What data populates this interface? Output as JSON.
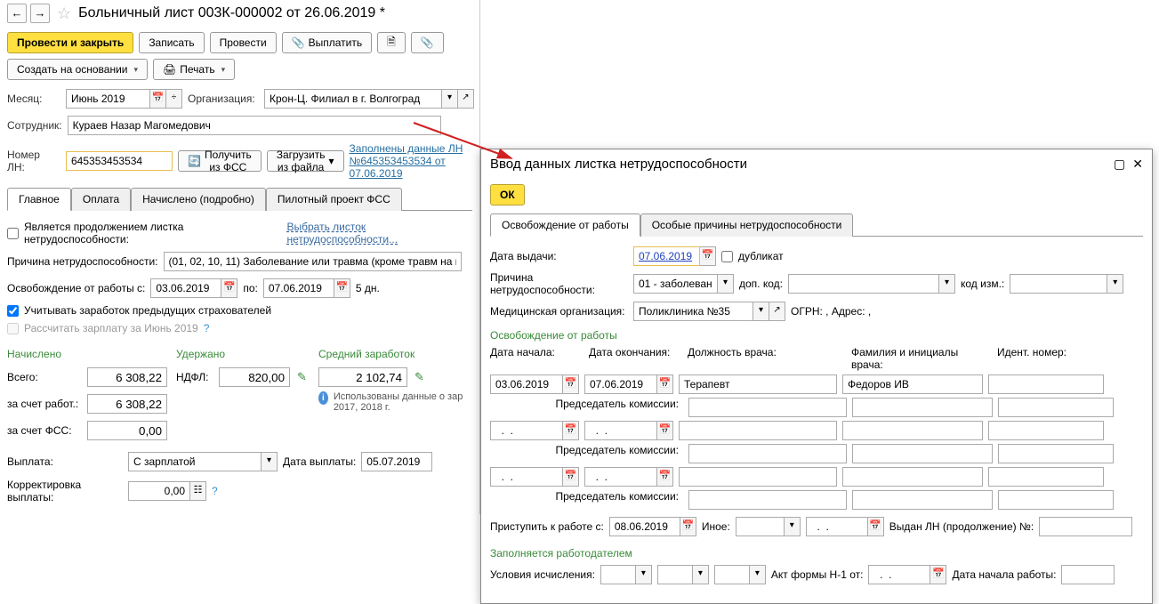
{
  "header": {
    "title": "Больничный лист 003К-000002 от 26.06.2019 *"
  },
  "toolbar": {
    "submit_close": "Провести и закрыть",
    "save": "Записать",
    "submit": "Провести",
    "pay": "Выплатить",
    "create_based": "Создать на основании",
    "print": "Печать"
  },
  "fields": {
    "month_label": "Месяц:",
    "month_value": "Июнь 2019",
    "org_label": "Организация:",
    "org_value": "Крон-Ц. Филиал в г. Волгоград",
    "employee_label": "Сотрудник:",
    "employee_value": "Кураев Назар Магомедович",
    "ln_label": "Номер ЛН:",
    "ln_value": "645353453534",
    "get_fss": "Получить из ФСС",
    "load_file": "Загрузить из файла",
    "filled_link": "Заполнены данные ЛН №645353453534 от 07.06.2019"
  },
  "tabs": {
    "main": "Главное",
    "payment": "Оплата",
    "accrued": "Начислено (подробно)",
    "pilot": "Пилотный проект ФСС"
  },
  "main_tab": {
    "continuation_label": "Является продолжением листка нетрудоспособности:",
    "choose_link": "Выбрать листок нетрудоспособности...",
    "reason_label": "Причина нетрудоспособности:",
    "reason_value": "(01, 02, 10, 11) Заболевание или травма (кроме травм на произв",
    "release_label": "Освобождение от работы с:",
    "release_from": "03.06.2019",
    "release_to_label": "по:",
    "release_to": "07.06.2019",
    "days": "5 дн.",
    "consider_prev": "Учитывать заработок предыдущих страхователей",
    "recalc": "Рассчитать зарплату за Июнь 2019",
    "accrued_header": "Начислено",
    "withheld_header": "Удержано",
    "avg_header": "Средний заработок",
    "total_label": "Всего:",
    "total_value": "6 308,22",
    "ndfl_label": "НДФЛ:",
    "ndfl_value": "820,00",
    "avg_value": "2 102,74",
    "employer_label": "за счет работ.:",
    "employer_value": "6 308,22",
    "info_text": "Использованы данные о зар 2017,  2018 г.",
    "fss_label": "за счет ФСС:",
    "fss_value": "0,00",
    "payment_label": "Выплата:",
    "payment_value": "С зарплатой",
    "payment_date_label": "Дата выплаты:",
    "payment_date": "05.07.2019",
    "correction_label": "Корректировка выплаты:",
    "correction_value": "0,00"
  },
  "dialog": {
    "title": "Ввод данных листка нетрудоспособности",
    "ok": "ОК",
    "tab1": "Освобождение от работы",
    "tab2": "Особые причины нетрудоспособности",
    "issue_date_label": "Дата выдачи:",
    "issue_date": "07.06.2019",
    "duplicate": "дубликат",
    "reason_label": "Причина нетрудоспособности:",
    "reason_value": "01 - заболевани",
    "addcode_label": "доп. код:",
    "chgcode_label": "код изм.:",
    "medorg_label": "Медицинская организация:",
    "medorg_value": "Поликлиника №35",
    "ogrn_label": "ОГРН: , Адрес: ,",
    "release_section": "Освобождение от работы",
    "start_label": "Дата начала:",
    "end_label": "Дата окончания:",
    "doctor_pos_label": "Должность врача:",
    "doctor_name_label": "Фамилия и инициалы врача:",
    "ident_label": "Идент. номер:",
    "start_value": "03.06.2019",
    "end_value": "07.06.2019",
    "doctor_pos": "Терапевт",
    "doctor_name": "Федоров ИВ",
    "chairman_label": "Председатель комиссии:",
    "empty_date": "  .  .    ",
    "return_label": "Приступить к работе с:",
    "return_date": "08.06.2019",
    "other_label": "Иное:",
    "issued_cont_label": "Выдан ЛН (продолжение) №:",
    "employer_section": "Заполняется работодателем",
    "calc_cond_label": "Условия исчисления:",
    "act_label": "Акт формы Н-1 от:",
    "work_start_label": "Дата начала работы:"
  }
}
